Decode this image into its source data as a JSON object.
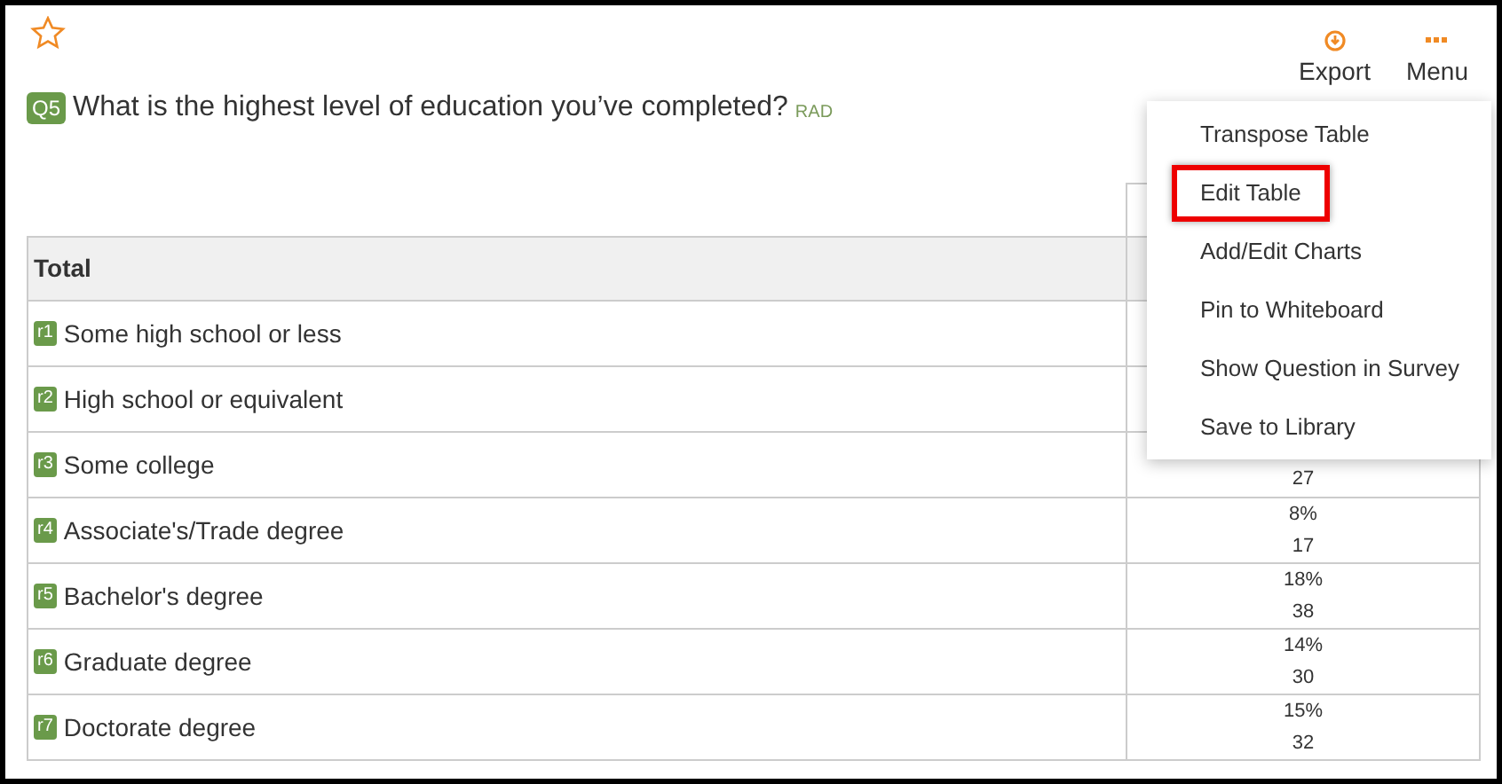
{
  "favorite": {
    "on": false
  },
  "actions": [
    {
      "kind": "export",
      "label": "Export"
    },
    {
      "kind": "menu",
      "label": "Menu"
    }
  ],
  "question": {
    "code": "Q5",
    "text": "What is the highest level of education you’ve completed?",
    "type": "RAD"
  },
  "table": {
    "header": "Total",
    "rows": [
      {
        "code": "r1",
        "label": "Some high school or less"
      },
      {
        "code": "r2",
        "label": "High school or equivalent"
      },
      {
        "code": "r3",
        "label": "Some college",
        "count": "27"
      },
      {
        "code": "r4",
        "label": "Associate's/Trade degree",
        "percent": "8%",
        "count": "17"
      },
      {
        "code": "r5",
        "label": "Bachelor's degree",
        "percent": "18%",
        "count": "38"
      },
      {
        "code": "r6",
        "label": "Graduate degree",
        "percent": "14%",
        "count": "30"
      },
      {
        "code": "r7",
        "label": "Doctorate degree",
        "percent": "15%",
        "count": "32"
      }
    ]
  },
  "menu": {
    "items": [
      {
        "label": "Transpose Table",
        "highlighted": false
      },
      {
        "label": "Edit Table",
        "highlighted": true
      },
      {
        "label": "Add/Edit Charts",
        "highlighted": false
      },
      {
        "label": "Pin to Whiteboard",
        "highlighted": false
      },
      {
        "label": "Show Question in Survey",
        "highlighted": false
      },
      {
        "label": "Save to Library",
        "highlighted": false
      }
    ]
  }
}
